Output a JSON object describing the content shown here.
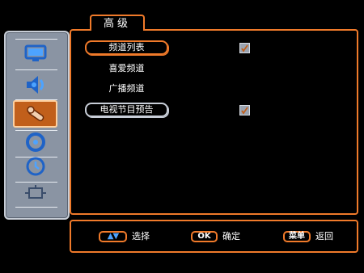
{
  "header": {
    "tab_title": "高级"
  },
  "sidebar": {
    "items": [
      {
        "icon": "tv-icon"
      },
      {
        "icon": "speaker-icon"
      },
      {
        "icon": "tools-icon",
        "selected": true
      },
      {
        "icon": "disc-icon"
      },
      {
        "icon": "clock-icon"
      },
      {
        "icon": "input-source-icon"
      }
    ]
  },
  "menu": {
    "items": [
      {
        "label": "频道列表",
        "state": "focused",
        "checkbox": true
      },
      {
        "label": "喜爱频道",
        "state": "normal",
        "checkbox": false
      },
      {
        "label": "广播频道",
        "state": "normal",
        "checkbox": false
      },
      {
        "label": "电视节目预告",
        "state": "selected",
        "checkbox": true
      }
    ]
  },
  "footer": {
    "select_key": "▲▼",
    "select_label": "选择",
    "ok_key": "OK",
    "ok_label": "确定",
    "menu_key": "菜单",
    "menu_label": "返回"
  },
  "colors": {
    "accent": "#f07a2a",
    "sidebar": "#8a94a3",
    "selected_icon_bg": "#c15f1b"
  }
}
